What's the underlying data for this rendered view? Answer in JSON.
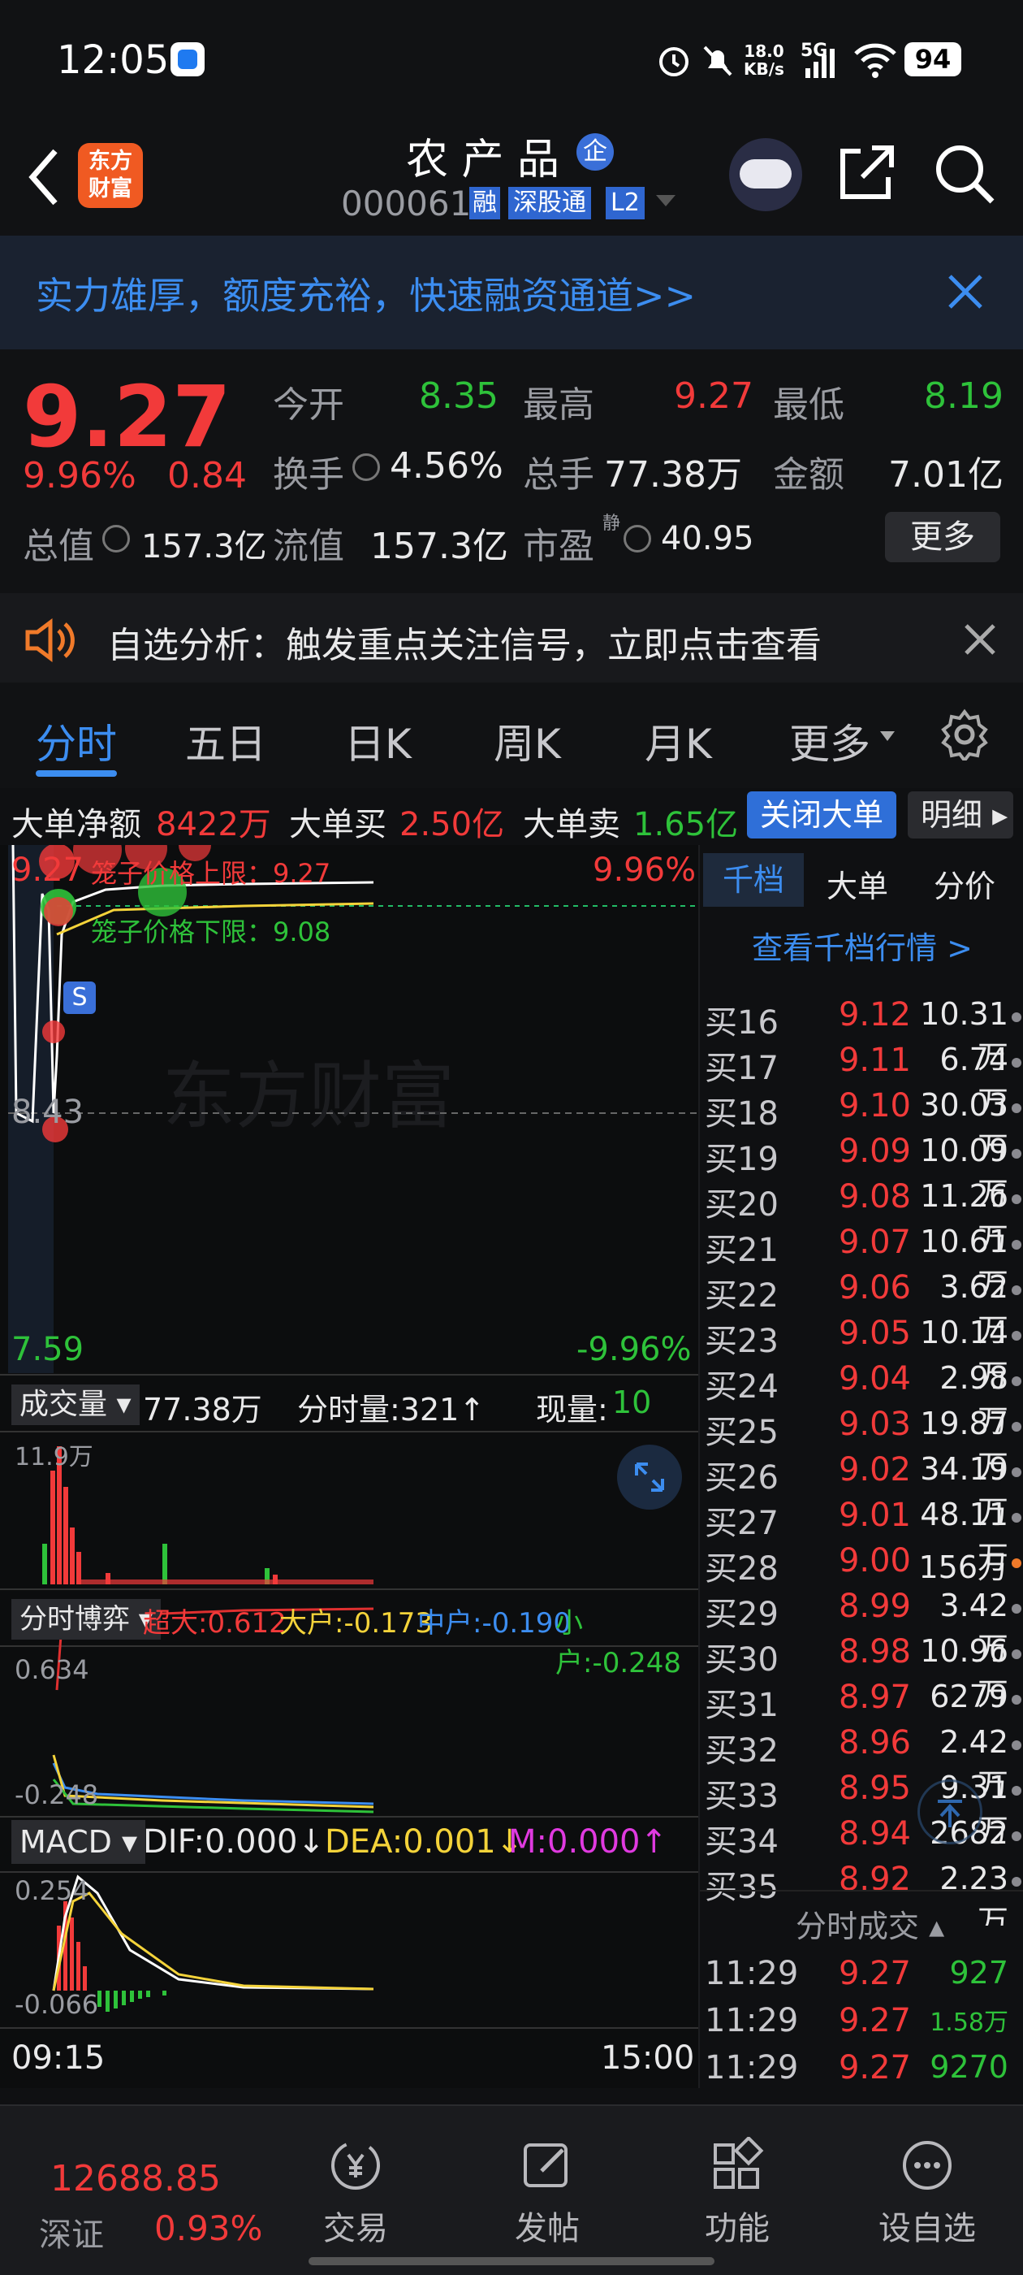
{
  "status_bar": {
    "time": "12:05",
    "net_speed_top": "18.0",
    "net_speed_bottom": "KB/s",
    "signal": "5G",
    "battery": "94"
  },
  "header": {
    "logo_text_1": "东方",
    "logo_text_2": "财富",
    "stock_name": "农 产 品",
    "badge_enterprise": "企",
    "stock_code": "000061",
    "tag_margin": "融",
    "tag_connect": "深股通",
    "tag_level": "L2"
  },
  "banner": {
    "text": "实力雄厚，额度充裕，快速融资通道>>"
  },
  "quote": {
    "price": "9.27",
    "change_pct": "9.96%",
    "change_amt": "0.84",
    "open_label": "今开",
    "open": "8.35",
    "high_label": "最高",
    "high": "9.27",
    "low_label": "最低",
    "low": "8.19",
    "turnover_label": "换手",
    "turnover": "4.56%",
    "volume_label": "总手",
    "volume": "77.38万",
    "amount_label": "金额",
    "amount": "7.01亿",
    "mktcap_label": "总值",
    "mktcap": "157.3亿",
    "float_label": "流值",
    "float": "157.3亿",
    "pe_label": "市盈",
    "pe_sup": "静",
    "pe": "40.95",
    "more_button": "更多"
  },
  "alert": {
    "text": "自选分析：触发重点关注信号，立即点击查看"
  },
  "tabs": [
    "分时",
    "五日",
    "日K",
    "周K",
    "月K",
    "更多"
  ],
  "big_order": {
    "net_label": "大单净额",
    "net": "8422万",
    "buy_label": "大单买",
    "buy": "2.50亿",
    "sell_label": "大单卖",
    "sell": "1.65亿",
    "close_button": "关闭大单",
    "detail_button": "明细"
  },
  "chart": {
    "price_top": "9.27",
    "pct_top": "9.96%",
    "price_mid": "8.43",
    "price_bottom": "7.59",
    "pct_bottom": "-9.96%",
    "cage_upper": "笼子价格上限：9.27",
    "cage_lower": "笼子价格下限：9.08",
    "watermark": "东方财富",
    "s_marker": "S",
    "vol_selector": "成交量",
    "vol_total": "77.38万",
    "vol_tick_label": "分时量:321",
    "vol_now_label": "现量:",
    "vol_now": "10",
    "vol_max": "11.9万",
    "game_selector": "分时博弈",
    "game_super": "超大:0.612",
    "game_big": "大户:-0.173",
    "game_mid": "中户:-0.190",
    "game_small": "小户:-0.248",
    "game_top": "0.634",
    "game_bottom": "-0.248",
    "macd_selector": "MACD",
    "macd_dif": "DIF:0.000",
    "macd_dea": "DEA:0.001",
    "macd_m": "M:0.000",
    "macd_top": "0.254",
    "macd_bottom": "-0.066",
    "time_start": "09:15",
    "time_end": "15:00"
  },
  "order_book": {
    "tabs": [
      "千档",
      "大单",
      "分价"
    ],
    "view_link": "查看千档行情 >",
    "rows": [
      {
        "label": "买16",
        "price": "9.12",
        "vol": "10.31万"
      },
      {
        "label": "买17",
        "price": "9.11",
        "vol": "6.74万"
      },
      {
        "label": "买18",
        "price": "9.10",
        "vol": "30.03万"
      },
      {
        "label": "买19",
        "price": "9.09",
        "vol": "10.09万"
      },
      {
        "label": "买20",
        "price": "9.08",
        "vol": "11.26万"
      },
      {
        "label": "买21",
        "price": "9.07",
        "vol": "10.61万"
      },
      {
        "label": "买22",
        "price": "9.06",
        "vol": "3.62万"
      },
      {
        "label": "买23",
        "price": "9.05",
        "vol": "10.14万"
      },
      {
        "label": "买24",
        "price": "9.04",
        "vol": "2.98万"
      },
      {
        "label": "买25",
        "price": "9.03",
        "vol": "19.87万"
      },
      {
        "label": "买26",
        "price": "9.02",
        "vol": "34.19万"
      },
      {
        "label": "买27",
        "price": "9.01",
        "vol": "48.11万"
      },
      {
        "label": "买28",
        "price": "9.00",
        "vol": "156万"
      },
      {
        "label": "买29",
        "price": "8.99",
        "vol": "3.42万"
      },
      {
        "label": "买30",
        "price": "8.98",
        "vol": "10.96万"
      },
      {
        "label": "买31",
        "price": "8.97",
        "vol": "6279"
      },
      {
        "label": "买32",
        "price": "8.96",
        "vol": "2.42万"
      },
      {
        "label": "买33",
        "price": "8.95",
        "vol": "9.31万"
      },
      {
        "label": "买34",
        "price": "8.94",
        "vol": "2682"
      },
      {
        "label": "买35",
        "price": "8.92",
        "vol": "2.23万"
      }
    ],
    "trades_title": "分时成交",
    "trades": [
      {
        "time": "11:29",
        "price": "9.27",
        "vol": "927"
      },
      {
        "time": "11:29",
        "price": "9.27",
        "vol": "1.58万"
      },
      {
        "time": "11:29",
        "price": "9.27",
        "vol": "9270"
      }
    ]
  },
  "bottom_nav": {
    "index_value": "12688.85",
    "index_name": "深证",
    "index_change": "0.93%",
    "trade": "交易",
    "post": "发帖",
    "function": "功能",
    "watchlist": "设自选"
  }
}
